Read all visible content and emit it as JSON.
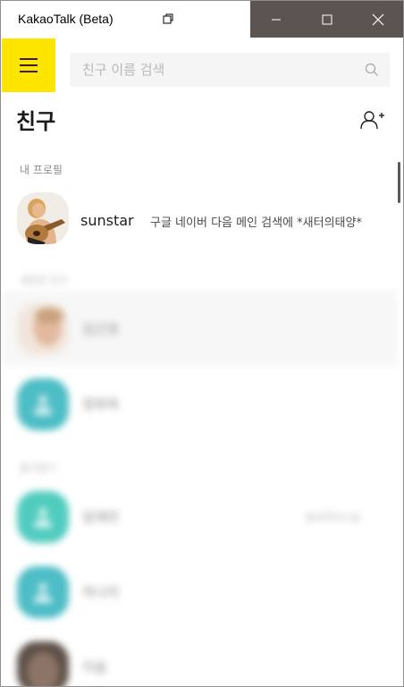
{
  "window": {
    "title": "KakaoTalk (Beta)",
    "controls": [
      "minimize",
      "maximize",
      "close"
    ]
  },
  "colors": {
    "accent": "#fee500",
    "titlebar_controls": "#5c5451",
    "default_avatar": "#4dbdc6"
  },
  "search": {
    "placeholder": "친구 이름 검색",
    "value": ""
  },
  "page": {
    "title": "친구"
  },
  "sections": {
    "my_profile": "내 프로필",
    "updated_friends": "새로운 친구",
    "friends": "즐겨찾기"
  },
  "profile": {
    "name": "sunstar",
    "status": "구글 네이버 다음 메인 검색에 *새터의태양*"
  },
  "friends": [
    {
      "name": "김근호",
      "extra": ""
    },
    {
      "name": "정희옥",
      "extra": ""
    },
    {
      "name": "임재민",
      "extra": "표브라더스날"
    },
    {
      "name": "하나리",
      "extra": ""
    },
    {
      "name": "이음",
      "extra": ""
    }
  ],
  "icons": {
    "menu": "hamburger-icon",
    "search": "search-icon",
    "add_friend": "add-friend-icon",
    "restore": "restore-window-icon"
  }
}
